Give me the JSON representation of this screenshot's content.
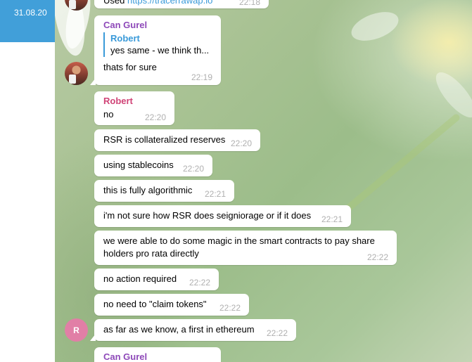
{
  "sidebar": {
    "date": "31.08.20"
  },
  "messages": [
    {
      "text_prefix": "Used ",
      "link": "https://tracerrawap.io",
      "time": "22:18"
    },
    {
      "sender": "Can Gurel",
      "reply_to": "Robert",
      "reply_text": "yes same - we think th...",
      "text": "thats for sure",
      "time": "22:19"
    },
    {
      "sender": "Robert",
      "text": "no",
      "time": "22:20"
    },
    {
      "text": "RSR is collateralized reserves",
      "time": "22:20"
    },
    {
      "text": "using stablecoins",
      "time": "22:20"
    },
    {
      "text": "this is fully algorithmic",
      "time": "22:21"
    },
    {
      "text": "i'm not sure how RSR does seigniorage or if it does",
      "time": "22:21"
    },
    {
      "text_line1": "we were able to do some magic in the smart contracts to pay share",
      "text_line2": "holders pro rata directly",
      "time": "22:22"
    },
    {
      "text": "no action required",
      "time": "22:22"
    },
    {
      "text": "no need to \"claim tokens\"",
      "time": "22:22"
    },
    {
      "text": "as far as we know, a first in ethereum",
      "time": "22:22"
    },
    {
      "sender": "Can Gurel"
    }
  ],
  "avatars": {
    "robert_initial": "R"
  },
  "colors": {
    "accent": "#419fd9",
    "can_gurel": "#8e49b9",
    "robert": "#d04477",
    "link": "#3a9ad9"
  }
}
